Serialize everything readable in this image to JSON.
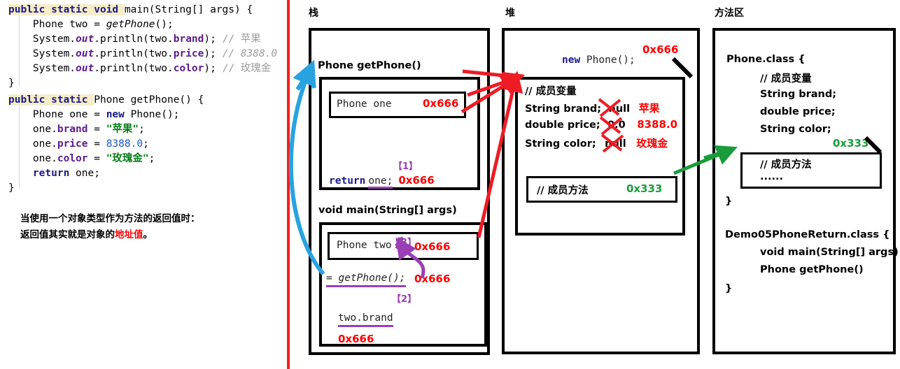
{
  "code_top": {
    "lines": [
      [
        {
          "t": "public static void ",
          "c": "kw-hl"
        },
        {
          "t": "main(String[] args) {",
          "c": ""
        }
      ],
      [
        {
          "t": "    Phone two = ",
          "c": ""
        },
        {
          "t": "getPhone",
          "c": "it"
        },
        {
          "t": "();",
          "c": ""
        }
      ],
      [
        {
          "t": "    System.",
          "c": ""
        },
        {
          "t": "out",
          "c": "fld it"
        },
        {
          "t": ".println(two.",
          "c": ""
        },
        {
          "t": "brand",
          "c": "fld"
        },
        {
          "t": "); ",
          "c": ""
        },
        {
          "t": "// 苹果",
          "c": "cmt"
        }
      ],
      [
        {
          "t": "    System.",
          "c": ""
        },
        {
          "t": "out",
          "c": "fld it"
        },
        {
          "t": ".println(two.",
          "c": ""
        },
        {
          "t": "price",
          "c": "fld"
        },
        {
          "t": "); ",
          "c": ""
        },
        {
          "t": "// 8388.0",
          "c": "cmt-i"
        }
      ],
      [
        {
          "t": "    System.",
          "c": ""
        },
        {
          "t": "out",
          "c": "fld it"
        },
        {
          "t": ".println(two.",
          "c": ""
        },
        {
          "t": "color",
          "c": "fld"
        },
        {
          "t": "); ",
          "c": ""
        },
        {
          "t": "// 玫瑰金",
          "c": "cmt"
        }
      ],
      [
        {
          "t": "}",
          "c": ""
        }
      ]
    ]
  },
  "code_bottom": {
    "lines": [
      [
        {
          "t": "public static ",
          "c": "kw-hl"
        },
        {
          "t": "Phone getPhone() {",
          "c": ""
        }
      ],
      [
        {
          "t": "    Phone one = ",
          "c": ""
        },
        {
          "t": "new",
          "c": "kw"
        },
        {
          "t": " Phone();",
          "c": ""
        }
      ],
      [
        {
          "t": "    one.",
          "c": ""
        },
        {
          "t": "brand",
          "c": "fld"
        },
        {
          "t": " = ",
          "c": ""
        },
        {
          "t": "\"苹果\"",
          "c": "str"
        },
        {
          "t": ";",
          "c": ""
        }
      ],
      [
        {
          "t": "    one.",
          "c": ""
        },
        {
          "t": "price",
          "c": "fld"
        },
        {
          "t": " = ",
          "c": ""
        },
        {
          "t": "8388.0",
          "c": "num"
        },
        {
          "t": ";",
          "c": ""
        }
      ],
      [
        {
          "t": "    one.",
          "c": ""
        },
        {
          "t": "color",
          "c": "fld"
        },
        {
          "t": " = ",
          "c": ""
        },
        {
          "t": "\"玫瑰金\"",
          "c": "str"
        },
        {
          "t": ";",
          "c": ""
        }
      ],
      [
        {
          "t": "    ",
          "c": ""
        },
        {
          "t": "return",
          "c": "kw"
        },
        {
          "t": " one;",
          "c": ""
        }
      ],
      [
        {
          "t": "}",
          "c": ""
        }
      ]
    ]
  },
  "note": {
    "line1": "当使用一个对象类型作为方法的返回值时：",
    "line2_a": "返回值其实就是对象的",
    "line2_hl": "地址值",
    "line2_b": "。"
  },
  "regions": {
    "stack_label": "栈",
    "heap_label": "堆",
    "method_area_label": "方法区"
  },
  "stack": {
    "frame1_title": "Phone getPhone()",
    "frame1_var_name": "Phone one",
    "frame1_var_addr": "0x666",
    "frame1_step": "【1】",
    "frame1_return_kw": "return",
    "frame1_return_var": "one;",
    "frame1_return_addr": "0x666",
    "frame2_title": "void main(String[] args)",
    "frame2_var_name": "Phone two",
    "frame2_step3": "【3】",
    "frame2_var_addr": "0x666",
    "frame2_call": "= getPhone();",
    "frame2_call_addr": "0x666",
    "frame2_step2": "【2】",
    "frame2_use": "two.brand",
    "frame2_use_addr": "0x666"
  },
  "heap": {
    "new_kw": "new",
    "new_rest": " Phone();",
    "obj_addr": "0x666",
    "comment_fields": "// 成员变量",
    "fields": [
      {
        "decl": "String brand;",
        "init": "null",
        "value": "苹果"
      },
      {
        "decl": "double price;",
        "init": "0.0",
        "value": "8388.0"
      },
      {
        "decl": "String color;",
        "init": "null",
        "value": "玫瑰金"
      }
    ],
    "method_comment": "// 成员方法",
    "method_addr": "0x333"
  },
  "method_area": {
    "phone_class_open": "Phone.class {",
    "phone_comment_fields": "// 成员变量",
    "phone_fields": [
      "String brand;",
      "double price;",
      "String color;"
    ],
    "method_addr": "0x333",
    "phone_method_comment": "// 成员方法",
    "phone_method_ellipsis": "......",
    "phone_class_close": "}",
    "demo_class_open": "Demo05PhoneReturn.class {",
    "demo_members": [
      "void main(String[] args)",
      "Phone getPhone()"
    ],
    "demo_class_close": "}"
  },
  "colors": {
    "divider": "#ff1a1a",
    "address_red": "#ff0000",
    "address_green": "#1a9c3c",
    "step_purple": "#9b3fb5",
    "arrow_blue": "#29a3e0",
    "arrow_red": "#ee1c25",
    "arrow_green": "#1a9c3c"
  }
}
